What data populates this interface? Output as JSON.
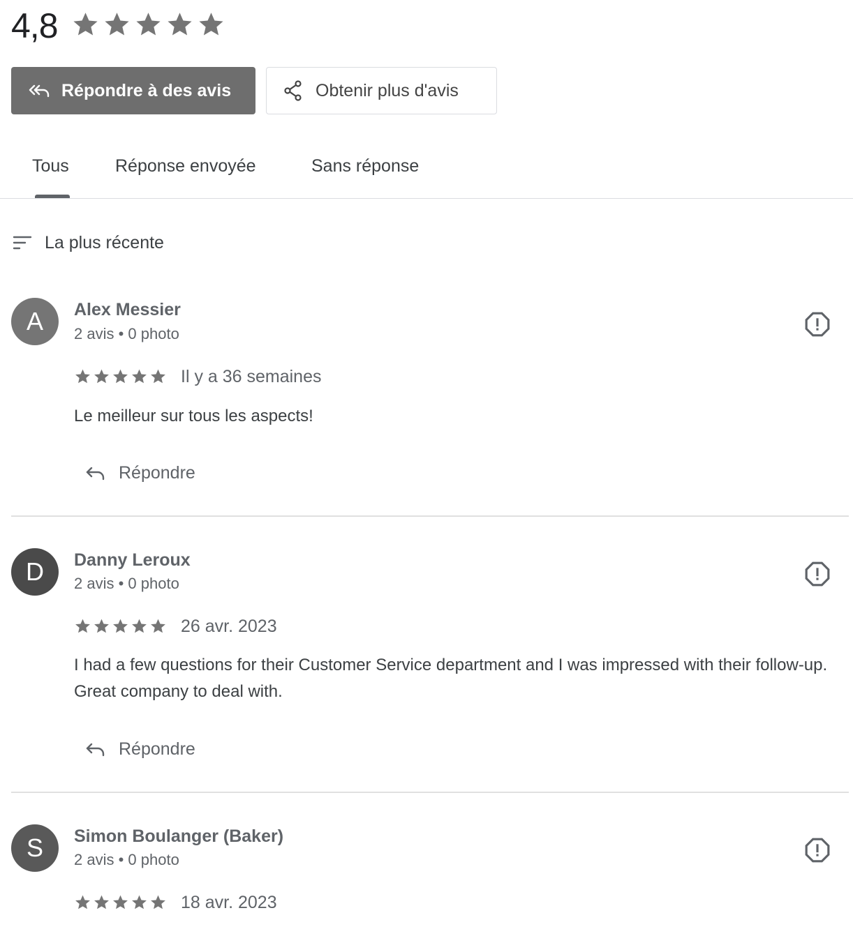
{
  "summary": {
    "rating": "4,8",
    "stars": 5,
    "star_color": "#757575"
  },
  "actions": {
    "reply_reviews_label": "Répondre à des avis",
    "get_more_reviews_label": "Obtenir plus d'avis"
  },
  "tabs": [
    {
      "label": "Tous",
      "active": true
    },
    {
      "label": "Réponse envoyée",
      "active": false
    },
    {
      "label": "Sans réponse",
      "active": false
    }
  ],
  "sort": {
    "label": "La plus récente"
  },
  "reviews": [
    {
      "initial": "A",
      "avatar_color": "#757575",
      "name": "Alex Messier",
      "meta": "2 avis • 0 photo",
      "stars": 5,
      "date": "Il y a 36 semaines",
      "text": "Le meilleur sur tous les aspects!",
      "reply_label": "Répondre"
    },
    {
      "initial": "D",
      "avatar_color": "#4a4a4a",
      "name": "Danny Leroux",
      "meta": "2 avis • 0 photo",
      "stars": 5,
      "date": "26 avr. 2023",
      "text": "I had a few questions for their Customer Service department and I was impressed with their follow-up. Great company to deal with.",
      "reply_label": "Répondre"
    },
    {
      "initial": "S",
      "avatar_color": "#595959",
      "name": "Simon Boulanger (Baker)",
      "meta": "2 avis • 0 photo",
      "stars": 5,
      "date": "18 avr. 2023",
      "text": "",
      "reply_label": ""
    }
  ],
  "icons": {
    "reply_all": "reply-all-icon",
    "share": "share-icon",
    "sort": "sort-icon",
    "reply": "reply-icon",
    "report": "report-icon",
    "star": "star-icon"
  }
}
